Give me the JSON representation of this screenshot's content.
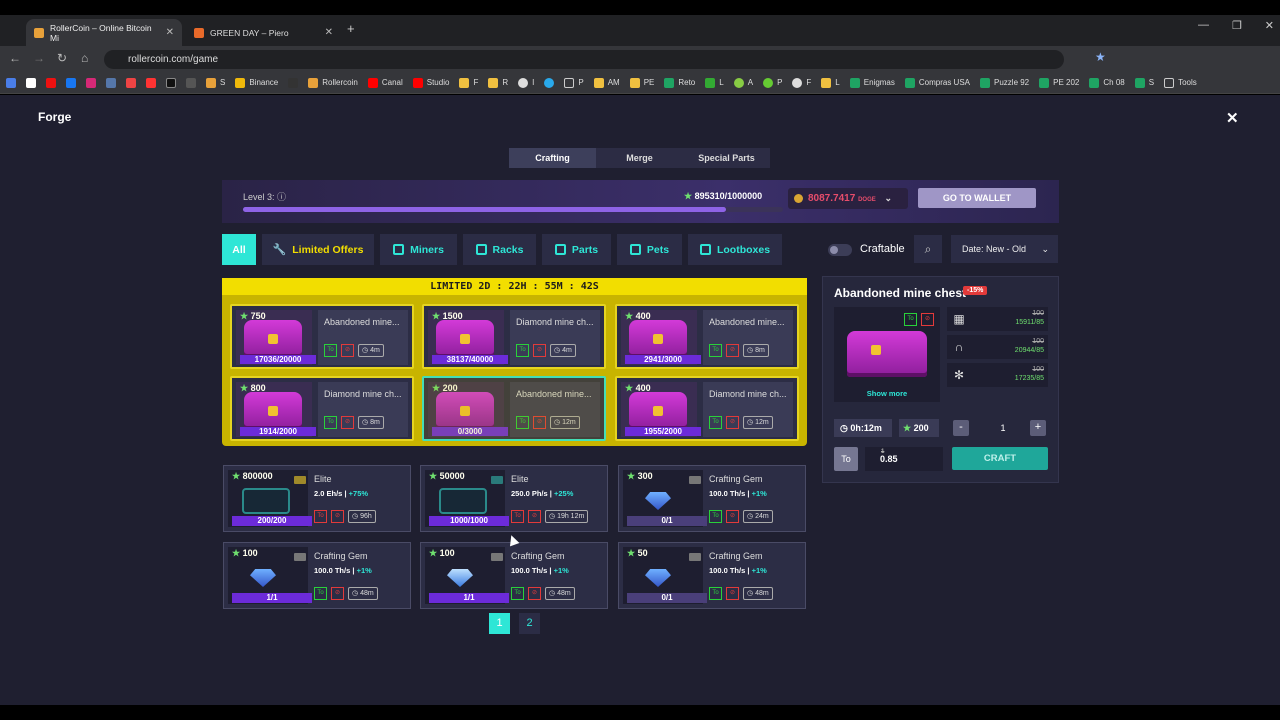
{
  "browser": {
    "tabs": [
      {
        "title": "RollerCoin – Online Bitcoin Mi",
        "active": true
      },
      {
        "title": "GREEN DAY – Piero",
        "active": false
      }
    ],
    "new_tab": "+",
    "url": "rollercoin.com/game",
    "bookmarks": [
      "S",
      "Binance",
      "Rollercoin",
      "Canal",
      "Studio",
      "F",
      "R",
      "I",
      "P",
      "AM",
      "PE",
      "Reto",
      "L",
      "A",
      "P",
      "F",
      "L",
      "Enigmas",
      "Compras USA",
      "Puzzle 92",
      "PE 202",
      "Ch 08",
      "S",
      "Tools"
    ]
  },
  "forge": {
    "title": "Forge",
    "close_icon": "✕",
    "tabs": [
      "Crafting",
      "Merge",
      "Special Parts"
    ],
    "active_tab": "Crafting",
    "level_label": "Level 3:",
    "level_progress": "895310/1000000",
    "level_fraction": 0.895,
    "balance": "8087.7417",
    "balance_currency": "DOGE",
    "wallet_button": "GO TO WALLET",
    "filters": [
      "All",
      "Limited Offers",
      "Miners",
      "Racks",
      "Parts",
      "Pets",
      "Lootboxes"
    ],
    "active_filter": "All",
    "craftable_label": "Craftable",
    "sort_label": "Date: New - Old",
    "limited_timer": "LIMITED 2D : 22H : 55M : 42S",
    "limited_cards": [
      {
        "stars": "750",
        "name": "Abandoned mine...",
        "time": "4m",
        "progress": "17036/20000"
      },
      {
        "stars": "1500",
        "name": "Diamond mine ch...",
        "time": "4m",
        "progress": "38137/40000"
      },
      {
        "stars": "400",
        "name": "Abandoned mine...",
        "time": "8m",
        "progress": "2941/3000"
      },
      {
        "stars": "800",
        "name": "Diamond mine ch...",
        "time": "8m",
        "progress": "1914/2000"
      },
      {
        "stars": "200",
        "name": "Abandoned mine...",
        "time": "12m",
        "progress": "0/3000"
      },
      {
        "stars": "400",
        "name": "Diamond mine ch...",
        "time": "12m",
        "progress": "1955/2000"
      }
    ],
    "items": [
      {
        "stars": "800000",
        "name": "Elite",
        "power": "2.0 Eh/s",
        "bonus": "+75%",
        "time": "96h",
        "progress": "200/200"
      },
      {
        "stars": "50000",
        "name": "Elite",
        "power": "250.0 Ph/s",
        "bonus": "+25%",
        "time": "19h 12m",
        "progress": "1000/1000"
      },
      {
        "stars": "300",
        "name": "Crafting Gem",
        "power": "100.0 Th/s",
        "bonus": "+1%",
        "time": "24m",
        "progress": "0/1"
      },
      {
        "stars": "100",
        "name": "Crafting Gem",
        "power": "100.0 Th/s",
        "bonus": "+1%",
        "time": "48m",
        "progress": "1/1"
      },
      {
        "stars": "100",
        "name": "Crafting Gem",
        "power": "100.0 Th/s",
        "bonus": "+1%",
        "time": "48m",
        "progress": "1/1"
      },
      {
        "stars": "50",
        "name": "Crafting Gem",
        "power": "100.0 Th/s",
        "bonus": "+1%",
        "time": "48m",
        "progress": "0/1"
      }
    ],
    "pages": [
      "1",
      "2"
    ],
    "detail": {
      "title": "Abandoned mine chest",
      "discount": "-15%",
      "show_more": "Show more",
      "parts": [
        {
          "icon": "grid-part-icon",
          "required": "100",
          "have": "15911/85"
        },
        {
          "icon": "magnet-part-icon",
          "required": "100",
          "have": "20944/85"
        },
        {
          "icon": "fan-part-icon",
          "required": "100",
          "have": "17235/85"
        }
      ],
      "time": "0h:12m",
      "stars": "200",
      "qty_minus": "-",
      "quantity": "1",
      "qty_plus": "+",
      "old_price": "1",
      "price": "0.85",
      "craft_button": "CRAFT"
    }
  }
}
